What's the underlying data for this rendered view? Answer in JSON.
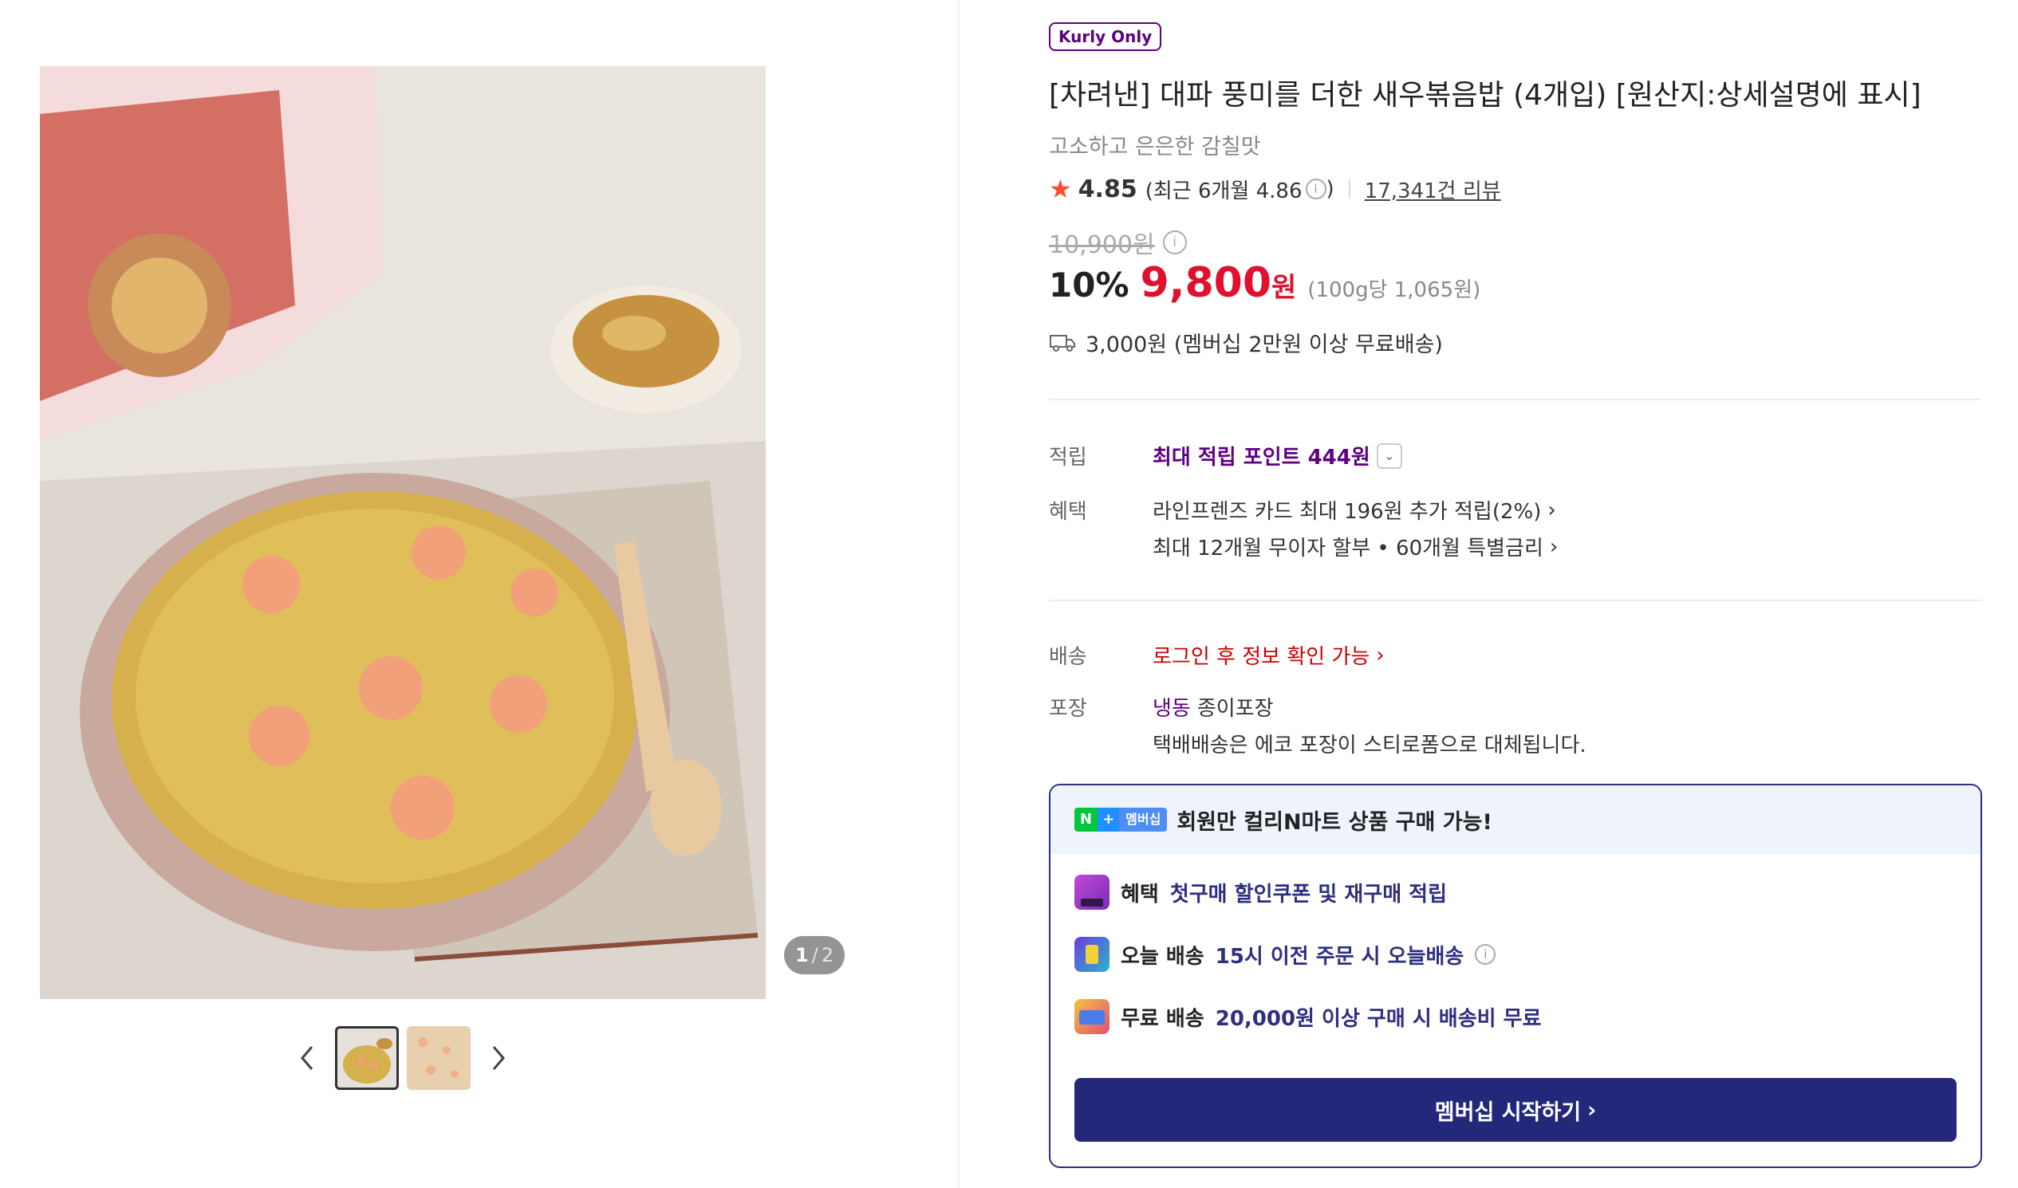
{
  "gallery": {
    "counter_current": "1",
    "counter_total": "2"
  },
  "product": {
    "badge": "Kurly Only",
    "title": "[차려낸] 대파 풍미를 더한 새우볶음밥 (4개입) [원산지:상세설명에 표시]",
    "subtitle": "고소하고 은은한 감칠맛",
    "rating": "4.85",
    "rating_recent": "(최근 6개월 4.86",
    "rating_recent_close": ")",
    "review_count": "17,341건 리뷰",
    "original_price": "10,900원",
    "discount": "10%",
    "price": "9,800",
    "price_unit": "원",
    "unit_price": "(100g당 1,065원)",
    "shipping": "3,000원 (멤버십 2만원 이상 무료배송)"
  },
  "details": {
    "points_label": "적립",
    "points_value": "최대 적립 포인트 444원",
    "benefits_label": "혜택",
    "benefit_1": "라인프렌즈 카드 최대 196원 추가 적립(2%)",
    "benefit_2": "최대 12개월 무이자 할부 • 60개월 특별금리",
    "delivery_label": "배송",
    "delivery_value": "로그인 후 정보 확인 가능",
    "packaging_label": "포장",
    "packaging_type": "냉동",
    "packaging_material": "종이포장",
    "packaging_note": "택배배송은 에코 포장이 스티로폼으로 대체됩니다."
  },
  "membership": {
    "n_badge": "N",
    "plus_badge": "+",
    "member_badge": "멤버십",
    "headline": "회원만 컬리N마트 상품 구매 가능!",
    "benefit_1_key": "혜택",
    "benefit_1_val": "첫구매 할인쿠폰 및 재구매 적립",
    "benefit_2_key": "오늘 배송",
    "benefit_2_val": "15시 이전 주문 시 오늘배송",
    "benefit_3_key": "무료 배송",
    "benefit_3_val": "20,000원 이상 구매 시 배송비 무료",
    "cta": "멤버십 시작하기"
  },
  "colors": {
    "brand_purple": "#5f0080",
    "price_red": "#e0102e",
    "member_navy": "#24287b"
  },
  "icons": [
    "chevron-left-icon",
    "chevron-right-icon",
    "star-icon",
    "info-icon",
    "delivery-truck-icon",
    "chevron-down-icon"
  ]
}
